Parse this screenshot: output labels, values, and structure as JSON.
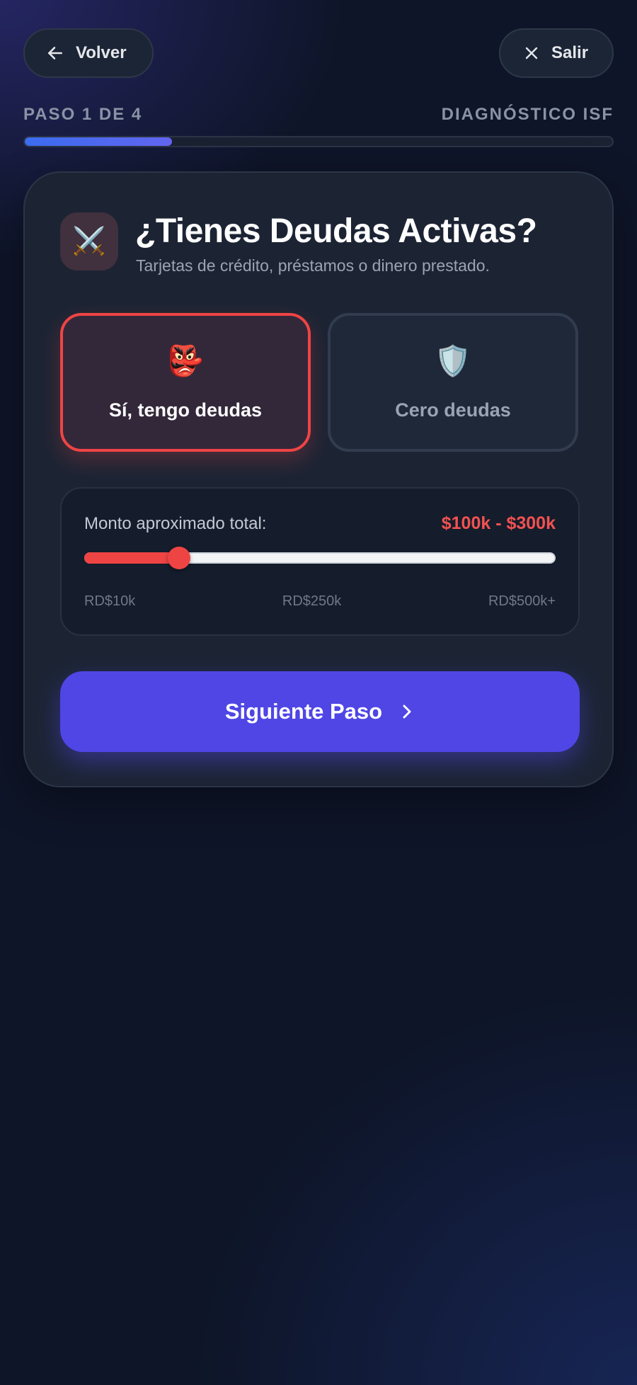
{
  "nav": {
    "back_label": "Volver",
    "exit_label": "Salir"
  },
  "progress": {
    "step_text": "PASO 1 DE 4",
    "section_title": "DIAGNÓSTICO ISF",
    "fraction": 0.25
  },
  "question": {
    "icon": "⚔️",
    "title": "¿Tienes Deudas Activas?",
    "subtitle": "Tarjetas de crédito, préstamos o dinero prestado."
  },
  "options": [
    {
      "emoji": "👺",
      "label": "Sí, tengo deudas",
      "selected": true
    },
    {
      "emoji": "🛡️",
      "label": "Cero deudas",
      "selected": false
    }
  ],
  "amount": {
    "label": "Monto aproximado total:",
    "value_text": "$100k - $300k",
    "slider_fraction": 0.2,
    "ticks": [
      "RD$10k",
      "RD$250k",
      "RD$500k+"
    ]
  },
  "cta": {
    "label": "Siguiente Paso"
  },
  "colors": {
    "accent": "#4f46e5",
    "danger": "#ef4444",
    "progress": "#3b6cf0"
  }
}
